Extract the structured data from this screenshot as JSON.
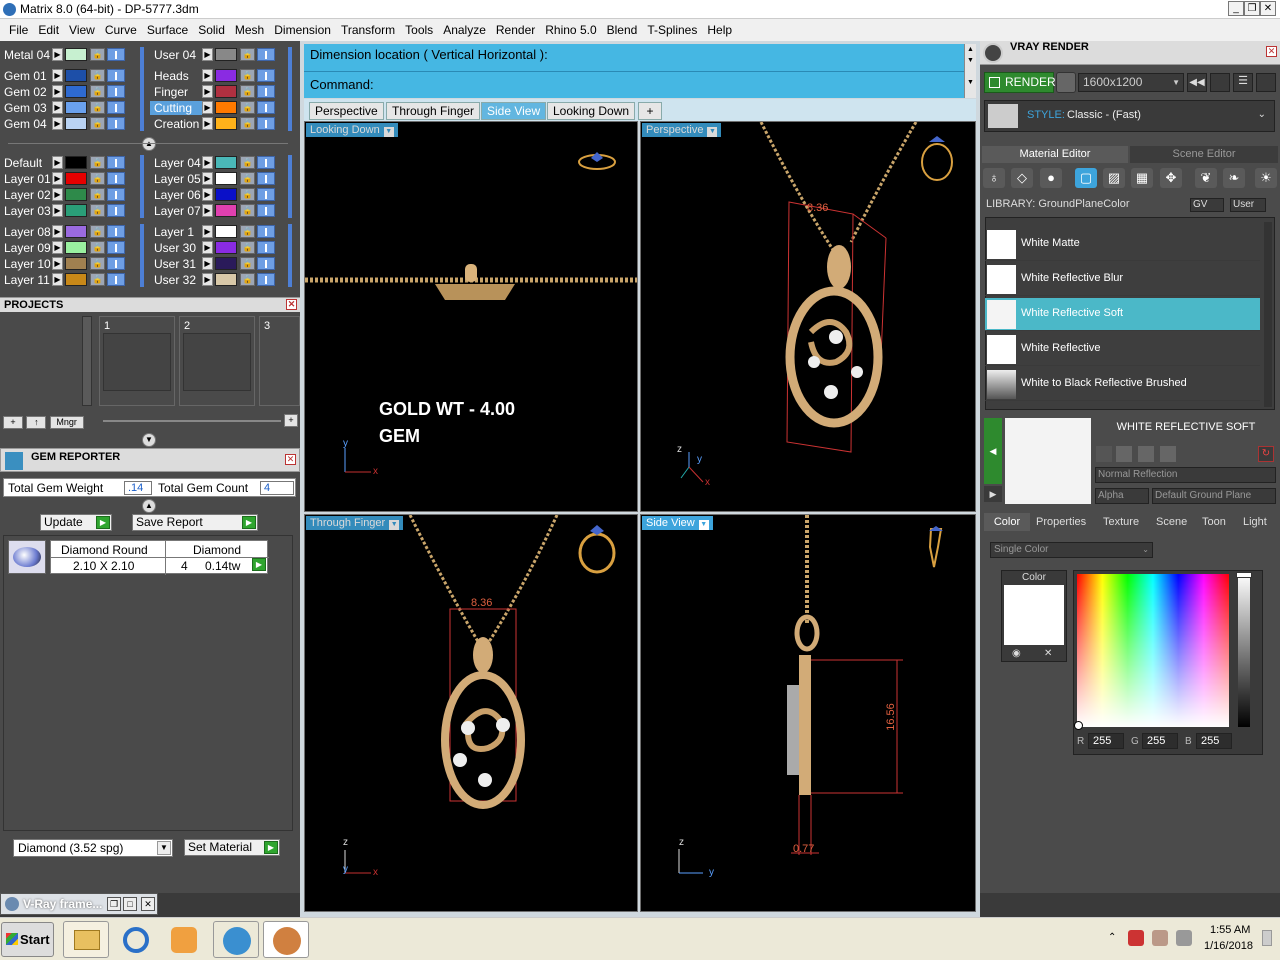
{
  "window": {
    "title": "Matrix 8.0 (64-bit) - DP-5777.3dm"
  },
  "menu": [
    "File",
    "Edit",
    "View",
    "Curve",
    "Surface",
    "Solid",
    "Mesh",
    "Dimension",
    "Transform",
    "Tools",
    "Analyze",
    "Render",
    "Rhino 5.0",
    "Blend",
    "T-Splines",
    "Help"
  ],
  "layers": {
    "group1_left": [
      {
        "name": "Metal 04",
        "color": "#c7f0d0"
      },
      {
        "name": "Gem 01",
        "color": "#1d4fa8"
      },
      {
        "name": "Gem 02",
        "color": "#2e6ad1"
      },
      {
        "name": "Gem 03",
        "color": "#6aa1ee"
      },
      {
        "name": "Gem 04",
        "color": "#b9d3f4"
      }
    ],
    "group1_right": [
      {
        "name": "User 04",
        "color": "#888888"
      },
      {
        "name": "Heads",
        "color": "#8a2be2"
      },
      {
        "name": "Finger",
        "color": "#b03040"
      },
      {
        "name": "Cutting",
        "color": "#ff7a00"
      },
      {
        "name": "Creation",
        "color": "#ffb21a"
      }
    ],
    "group2_left": [
      {
        "name": "Default",
        "color": "#000000"
      },
      {
        "name": "Layer 01",
        "color": "#e60000"
      },
      {
        "name": "Layer 02",
        "color": "#2e8a4a"
      },
      {
        "name": "Layer 03",
        "color": "#2a9e78"
      }
    ],
    "group2_right": [
      {
        "name": "Layer 04",
        "color": "#4ab8b8"
      },
      {
        "name": "Layer 05",
        "color": "#ffffff"
      },
      {
        "name": "Layer 06",
        "color": "#0a10c8"
      },
      {
        "name": "Layer 07",
        "color": "#e040b0"
      }
    ],
    "group3_left": [
      {
        "name": "Layer 08",
        "color": "#9a6ae0"
      },
      {
        "name": "Layer 09",
        "color": "#9af0a0"
      },
      {
        "name": "Layer 10",
        "color": "#a08050"
      },
      {
        "name": "Layer 11",
        "color": "#c88818"
      }
    ],
    "group3_right": [
      {
        "name": "Layer 1",
        "color": "#ffffff"
      },
      {
        "name": "User 30",
        "color": "#8a2be2"
      },
      {
        "name": "User 31",
        "color": "#2a1a5a"
      },
      {
        "name": "User 32",
        "color": "#d8c8a8"
      }
    ]
  },
  "projects": {
    "title": "PROJECTS",
    "slots": [
      "1",
      "2",
      "3"
    ],
    "mngr": "Mngr"
  },
  "gem_reporter": {
    "title": "GEM REPORTER",
    "total_weight_label": "Total Gem Weight",
    "total_weight": ".14",
    "total_count_label": "Total Gem Count",
    "total_count": "4",
    "update": "Update",
    "save_report": "Save Report",
    "row": {
      "shape": "Diamond Round",
      "size": "2.10 X 2.10",
      "material": "Diamond",
      "count": "4",
      "weight": "0.14tw"
    },
    "material_select": "Diamond    (3.52 spg)",
    "set_material": "Set Material"
  },
  "command": {
    "prompt1": "Dimension location ( Vertical  Horizontal ):",
    "prompt2": "Command:"
  },
  "view_tabs": [
    "Perspective",
    "Through Finger",
    "Side View",
    "Looking Down"
  ],
  "active_view_tab": "Side View",
  "viewports": {
    "top_left": {
      "label": "Looking Down",
      "overlay1": "GOLD WT - 4.00",
      "overlay2": "GEM"
    },
    "top_right": {
      "label": "Perspective",
      "dim": "8.36"
    },
    "bottom_left": {
      "label": "Through Finger",
      "dim": "8.36"
    },
    "bottom_right": {
      "label": "Side View",
      "dim1": "16.56",
      "dim2": "0.77"
    }
  },
  "vray": {
    "title": "VRAY RENDER",
    "render": "RENDER",
    "resolution": "1600x1200",
    "style_label": "STYLE:",
    "style_value": "Classic - (Fast)",
    "tabs": [
      "Material Editor",
      "Scene Editor"
    ],
    "library_label": "LIBRARY: GroundPlaneColor",
    "gv": "GV",
    "user": "User",
    "materials": [
      "White Matte",
      "White Reflective Blur",
      "White Reflective Soft",
      "White Reflective",
      "White to Black Reflective Brushed"
    ],
    "selected_material": "White Reflective Soft",
    "preview_title": "WHITE REFLECTIVE SOFT",
    "reflection": "Normal Reflection",
    "alpha": "Alpha",
    "ground": "Default Ground Plane",
    "prop_tabs": [
      "Color",
      "Properties",
      "Texture",
      "Scene",
      "Toon",
      "Light"
    ],
    "color_mode": "Single Color",
    "color_label": "Color",
    "r_label": "R",
    "g_label": "G",
    "b_label": "B",
    "r": "255",
    "g": "255",
    "b": "255"
  },
  "vray_frame": {
    "title": "V-Ray frame..."
  },
  "taskbar": {
    "start": "Start",
    "time": "1:55 AM",
    "date": "1/16/2018"
  }
}
